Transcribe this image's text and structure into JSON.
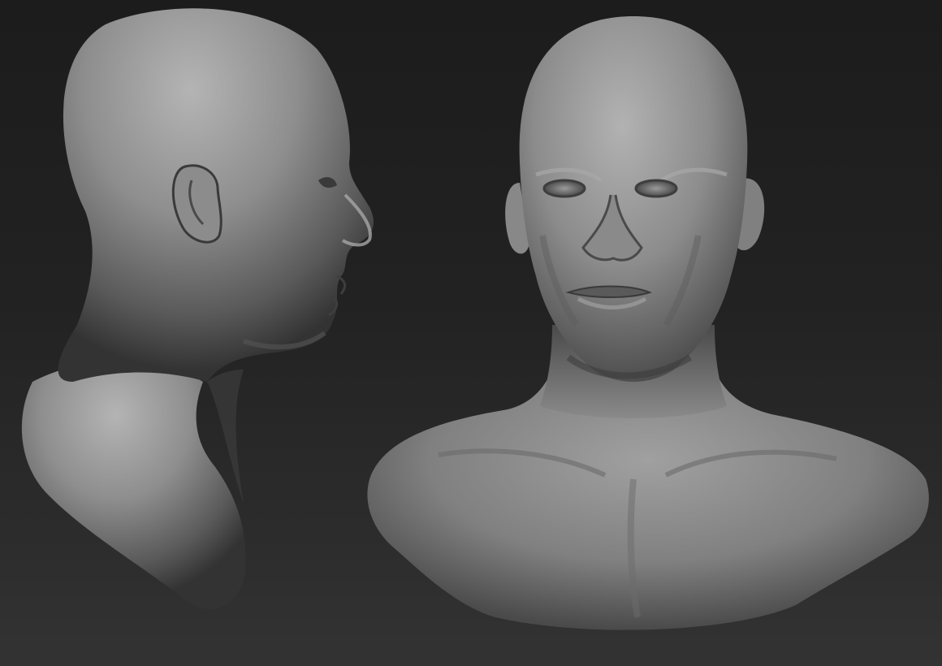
{
  "scene": {
    "background_top": "#1c1c1c",
    "background_bottom": "#333333",
    "material_light": "#b0b0b0",
    "material_mid": "#7e7e7e",
    "material_dark": "#2e2e2e",
    "models": [
      {
        "name": "side-profile-bust",
        "view": "profile-right"
      },
      {
        "name": "front-bust",
        "view": "front"
      }
    ]
  }
}
